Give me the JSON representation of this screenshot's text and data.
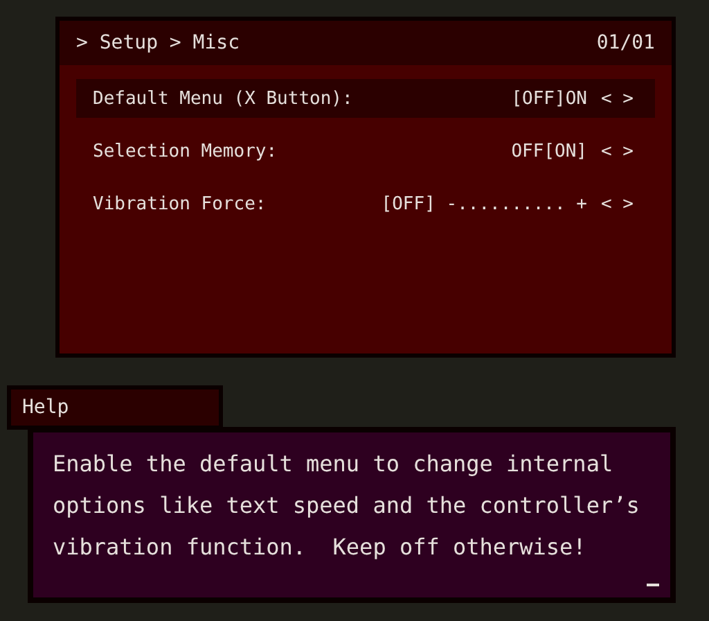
{
  "header": {
    "breadcrumb": "> Setup > Misc",
    "page": "01/01"
  },
  "options": [
    {
      "label": "Default Menu (X Button):",
      "value": "[OFF]ON",
      "arrows": "< >",
      "selected": true
    },
    {
      "label": "Selection Memory:",
      "value": "OFF[ON]",
      "arrows": "< >",
      "selected": false
    },
    {
      "label": "Vibration Force:",
      "value": "[OFF] -.......... +",
      "arrows": "< >",
      "selected": false
    }
  ],
  "help": {
    "title": "Help",
    "text": "Enable the default menu to change internal options like text speed and the controller’s vibration function.  Keep off otherwise!",
    "cursor": true
  }
}
